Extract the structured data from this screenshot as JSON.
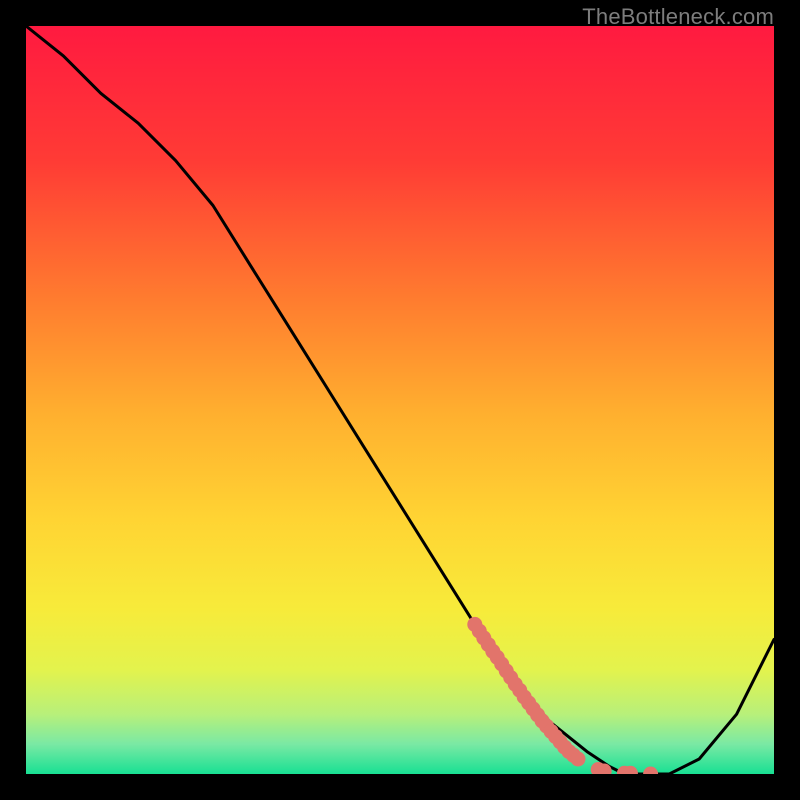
{
  "watermark": "TheBottleneck.com",
  "chart_data": {
    "type": "line",
    "title": "",
    "xlabel": "",
    "ylabel": "",
    "xlim": [
      0,
      100
    ],
    "ylim": [
      0,
      100
    ],
    "grid": false,
    "legend": false,
    "series": [
      {
        "name": "curve",
        "color": "#000000",
        "x": [
          0,
          5,
          10,
          15,
          20,
          25,
          30,
          35,
          40,
          45,
          50,
          55,
          60,
          65,
          70,
          75,
          78,
          80,
          83,
          86,
          90,
          95,
          100
        ],
        "y": [
          100,
          96,
          91,
          87,
          82,
          76,
          68,
          60,
          52,
          44,
          36,
          28,
          20,
          13,
          7,
          3,
          1,
          0,
          0,
          0,
          2,
          8,
          18
        ]
      }
    ],
    "markers": {
      "name": "highlight-dots",
      "color": "#e2746b",
      "points": [
        {
          "x": 60.0,
          "y": 20.0
        },
        {
          "x": 60.6,
          "y": 19.1
        },
        {
          "x": 61.2,
          "y": 18.2
        },
        {
          "x": 61.8,
          "y": 17.3
        },
        {
          "x": 62.4,
          "y": 16.4
        },
        {
          "x": 63.0,
          "y": 15.6
        },
        {
          "x": 63.6,
          "y": 14.7
        },
        {
          "x": 64.2,
          "y": 13.8
        },
        {
          "x": 64.8,
          "y": 12.9
        },
        {
          "x": 65.4,
          "y": 12.0
        },
        {
          "x": 66.0,
          "y": 11.2
        },
        {
          "x": 66.6,
          "y": 10.3
        },
        {
          "x": 67.2,
          "y": 9.5
        },
        {
          "x": 67.8,
          "y": 8.7
        },
        {
          "x": 68.4,
          "y": 7.9
        },
        {
          "x": 69.0,
          "y": 7.1
        },
        {
          "x": 69.6,
          "y": 6.4
        },
        {
          "x": 70.2,
          "y": 5.7
        },
        {
          "x": 70.8,
          "y": 5.0
        },
        {
          "x": 71.4,
          "y": 4.3
        },
        {
          "x": 72.0,
          "y": 3.6
        },
        {
          "x": 72.6,
          "y": 3.0
        },
        {
          "x": 73.2,
          "y": 2.5
        },
        {
          "x": 73.8,
          "y": 2.0
        },
        {
          "x": 76.5,
          "y": 0.6
        },
        {
          "x": 77.3,
          "y": 0.4
        },
        {
          "x": 80.0,
          "y": 0.1
        },
        {
          "x": 80.8,
          "y": 0.1
        },
        {
          "x": 83.5,
          "y": 0.0
        }
      ]
    },
    "gradient_stops": [
      {
        "pos": 0.0,
        "color": "#ff1a40"
      },
      {
        "pos": 0.18,
        "color": "#ff3b35"
      },
      {
        "pos": 0.36,
        "color": "#ff7a2f"
      },
      {
        "pos": 0.52,
        "color": "#ffb02f"
      },
      {
        "pos": 0.66,
        "color": "#ffd433"
      },
      {
        "pos": 0.78,
        "color": "#f7eb3a"
      },
      {
        "pos": 0.86,
        "color": "#e3f34d"
      },
      {
        "pos": 0.92,
        "color": "#b8f07a"
      },
      {
        "pos": 0.96,
        "color": "#7ae9a4"
      },
      {
        "pos": 1.0,
        "color": "#18e093"
      }
    ]
  }
}
